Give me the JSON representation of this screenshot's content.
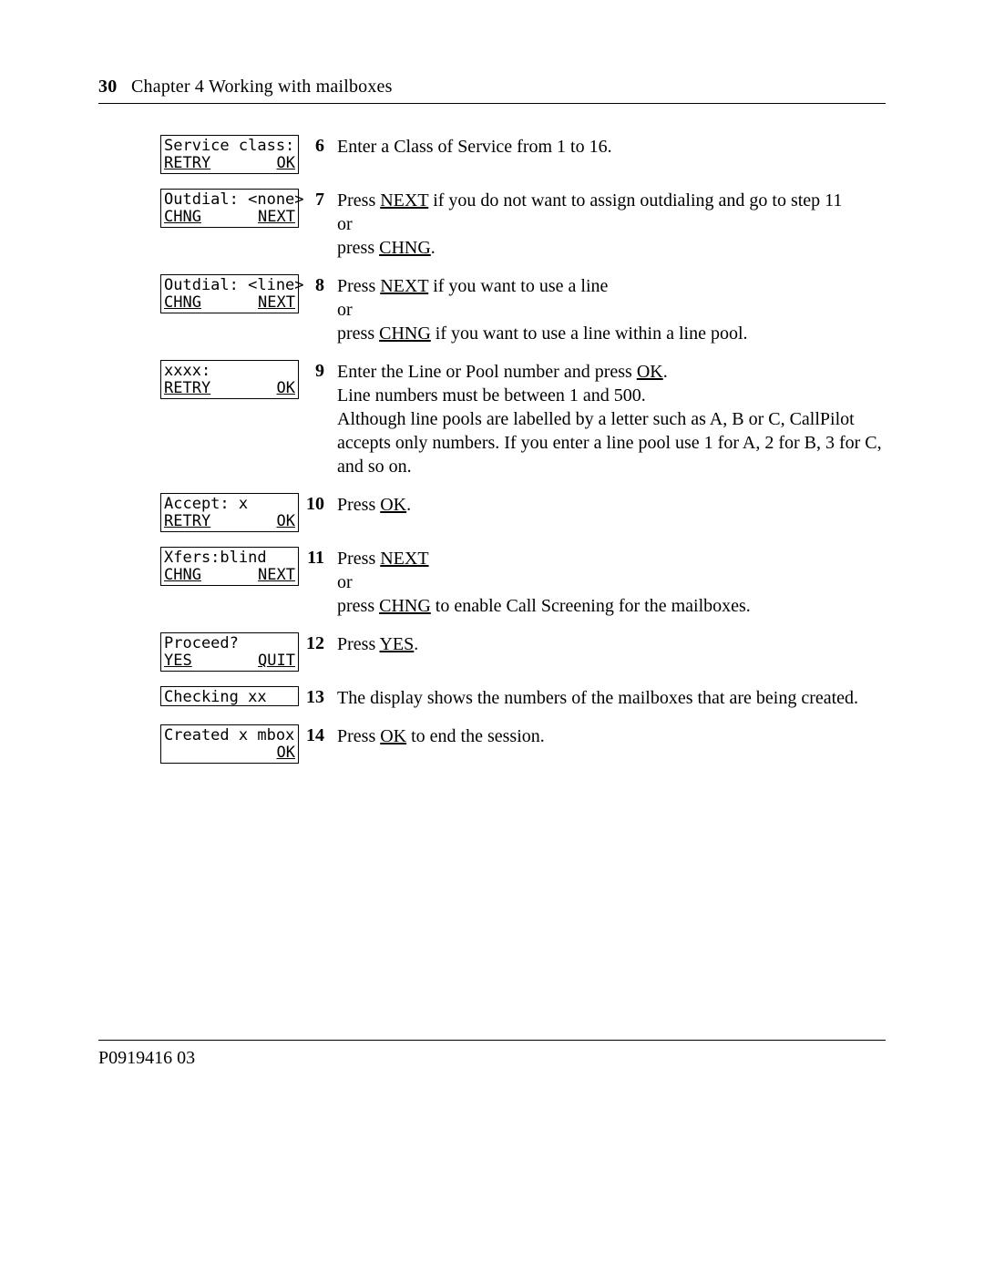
{
  "header": {
    "page_no": "30",
    "chapter": "Chapter 4  Working with mailboxes"
  },
  "footer": {
    "doc_id": "P0919416 03"
  },
  "btn": {
    "next": "NEXT",
    "chng": "CHNG",
    "ok": "OK",
    "yes": "YES",
    "retry": "RETRY",
    "quit": "QUIT"
  },
  "steps": {
    "s6": {
      "num": "6",
      "lcd_top": "Service class:",
      "lcd_left": "RETRY",
      "lcd_right": "OK",
      "p1a": "Enter a Class of Service from 1 to 16."
    },
    "s7": {
      "num": "7",
      "lcd_top": "Outdial: <none>",
      "lcd_left": "CHNG",
      "lcd_right": "NEXT",
      "p1a": "Press ",
      "p1b": " if you do not want to assign outdialing and go to step 11",
      "p2": "or",
      "p3a": "press ",
      "p3b": "."
    },
    "s8": {
      "num": "8",
      "lcd_top": "Outdial: <line>",
      "lcd_left": "CHNG",
      "lcd_right": "NEXT",
      "p1a": "Press ",
      "p1b": " if you want to use a line",
      "p2": "or",
      "p3a": "press ",
      "p3b": " if you want to use a line within a line pool."
    },
    "s9": {
      "num": "9",
      "lcd_top": "xxxx:",
      "lcd_left": "RETRY",
      "lcd_right": "OK",
      "p1a": "Enter the Line or Pool number and press ",
      "p1b": ".",
      "p2": "Line numbers must be between 1 and 500.",
      "p3": "Although line pools are labelled by a letter such as A, B or C, CallPilot accepts only numbers. If you enter a line pool use 1 for A, 2 for B, 3 for C, and so on."
    },
    "s10": {
      "num": "10",
      "lcd_top": "Accept: x",
      "lcd_left": "RETRY",
      "lcd_right": "OK",
      "p1a": "Press ",
      "p1b": "."
    },
    "s11": {
      "num": "11",
      "lcd_top": "Xfers:blind",
      "lcd_left": "CHNG",
      "lcd_right": "NEXT",
      "p1a": "Press ",
      "p2": "or",
      "p3a": "press ",
      "p3b": " to enable Call Screening for the mailboxes."
    },
    "s12": {
      "num": "12",
      "lcd_top": "Proceed?",
      "lcd_left": "YES",
      "lcd_right": "QUIT",
      "p1a": "Press ",
      "p1b": "."
    },
    "s13": {
      "num": "13",
      "lcd_top": "Checking xx",
      "p1": "The display shows the numbers of the mailboxes that are being created."
    },
    "s14": {
      "num": "14",
      "lcd_top": "Created x mbox",
      "lcd_right": "OK",
      "p1a": "Press ",
      "p1b": " to end the session."
    }
  }
}
